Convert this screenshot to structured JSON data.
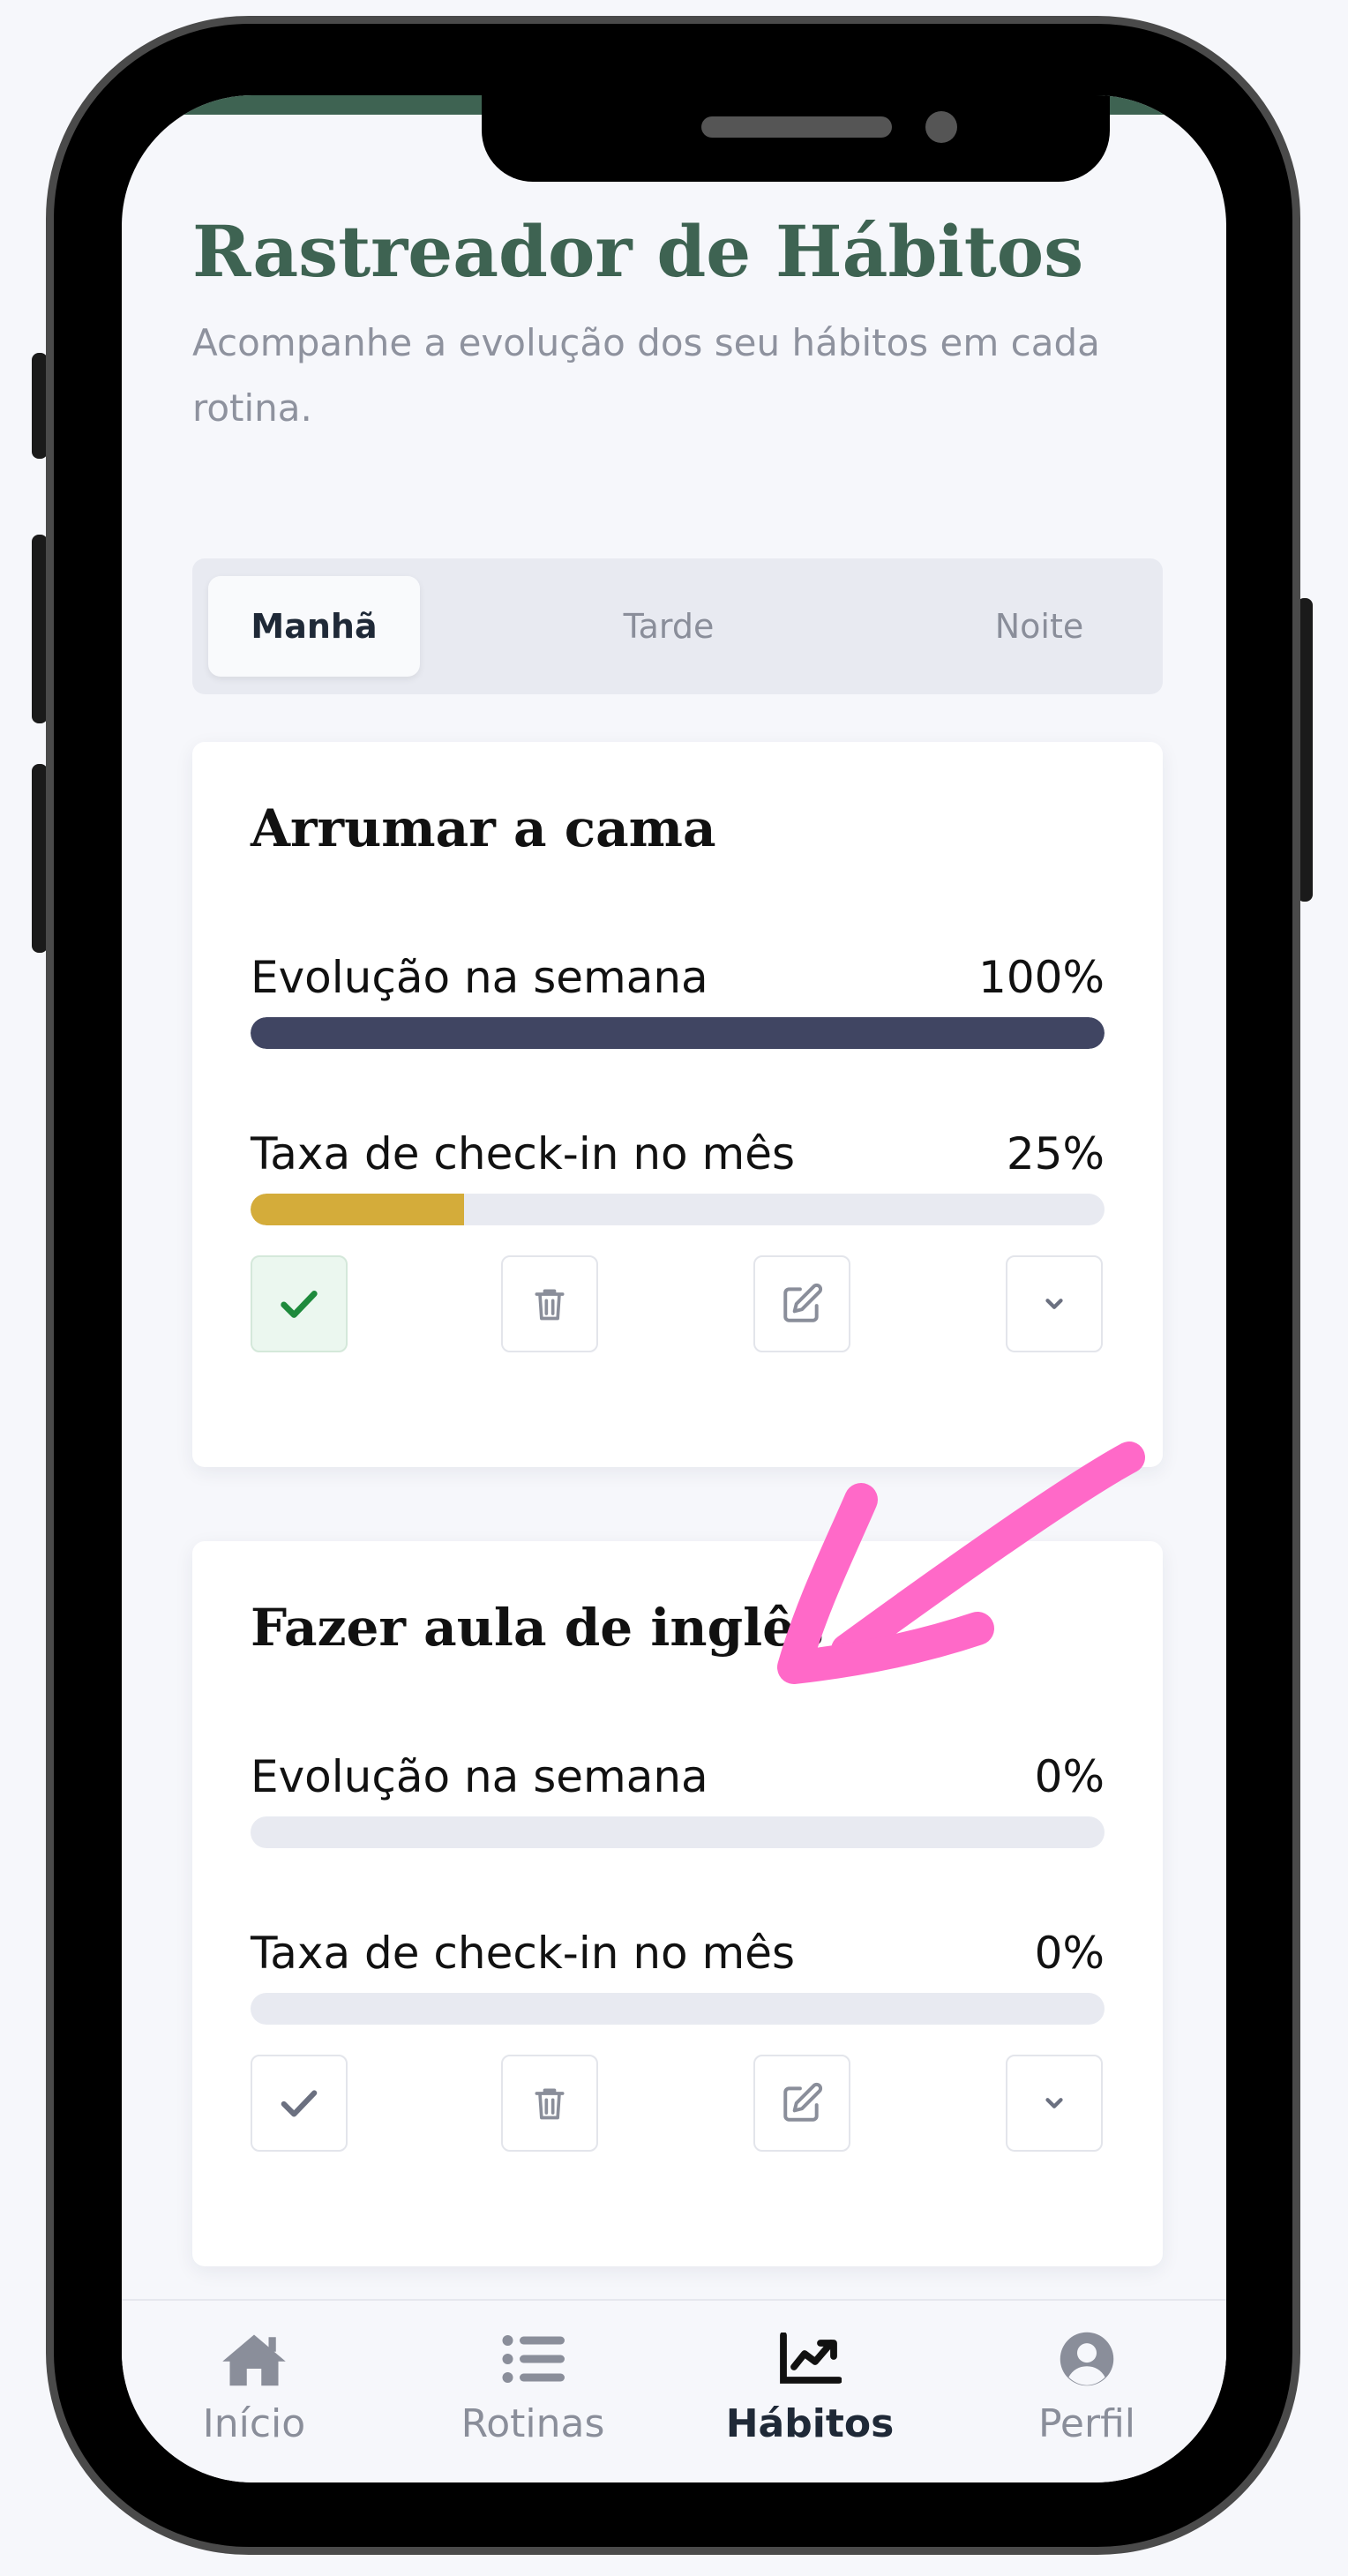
{
  "header": {
    "title": "Rastreador de Hábitos",
    "subtitle": "Acompanhe a evolução dos seu hábitos em cada rotina."
  },
  "tabs": [
    {
      "label": "Manhã",
      "active": true
    },
    {
      "label": "Tarde",
      "active": false
    },
    {
      "label": "Noite",
      "active": false
    }
  ],
  "habits": [
    {
      "title": "Arrumar a cama",
      "weekly_label": "Evolução na semana",
      "weekly_value": "100%",
      "weekly_progress": 100,
      "monthly_label": "Taxa de check-in no mês",
      "monthly_value": "25%",
      "monthly_progress": 25,
      "checked_in": true,
      "actions": [
        "check-icon",
        "trash-icon",
        "edit-icon",
        "chevron-down-icon"
      ]
    },
    {
      "title": "Fazer aula de inglês",
      "weekly_label": "Evolução na semana",
      "weekly_value": "0%",
      "weekly_progress": 0,
      "monthly_label": "Taxa de check-in no mês",
      "monthly_value": "0%",
      "monthly_progress": 0,
      "checked_in": false,
      "actions": [
        "check-icon",
        "trash-icon",
        "edit-icon",
        "chevron-down-icon"
      ]
    }
  ],
  "bottom_nav": [
    {
      "label": "Início",
      "icon": "home-icon",
      "active": false
    },
    {
      "label": "Rotinas",
      "icon": "list-icon",
      "active": false
    },
    {
      "label": "Hábitos",
      "icon": "chart-line-icon",
      "active": true
    },
    {
      "label": "Perfil",
      "icon": "user-circle-icon",
      "active": false
    }
  ],
  "colors": {
    "brand_green": "#3e6352",
    "weekly_bar": "#404562",
    "monthly_bar": "#d4ac3a",
    "check_green": "#1e8a3c",
    "annotation_pink": "#ff69c8"
  }
}
